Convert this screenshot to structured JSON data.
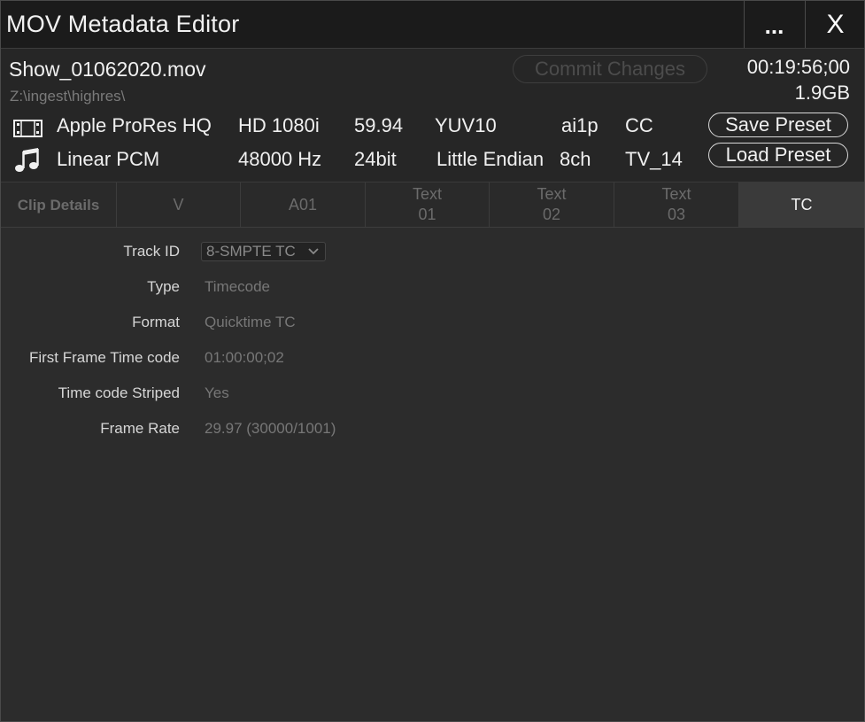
{
  "window": {
    "title": "MOV Metadata Editor",
    "more_label": "...",
    "close_label": "X"
  },
  "file": {
    "name": "Show_01062020.mov",
    "path": "Z:\\ingest\\highres\\",
    "duration": "00:19:56;00",
    "size": "1.9GB",
    "commit_label": "Commit Changes"
  },
  "video": {
    "icon": "film-icon",
    "codec": "Apple ProRes HQ",
    "resolution": "HD 1080i",
    "frame_rate": "59.94",
    "color": "YUV10",
    "fourcc": "ai1p",
    "captions": "CC"
  },
  "audio": {
    "icon": "music-note-icon",
    "codec": "Linear PCM",
    "sample_rate": "48000 Hz",
    "bit_depth": "24bit",
    "endian": "Little Endian",
    "channels": "8ch",
    "rating": "TV_14"
  },
  "presets": {
    "save_label": "Save Preset",
    "load_label": "Load Preset"
  },
  "tabs": [
    {
      "line1": "Clip Details",
      "line2": ""
    },
    {
      "line1": "V",
      "line2": ""
    },
    {
      "line1": "A01",
      "line2": ""
    },
    {
      "line1": "Text",
      "line2": "01"
    },
    {
      "line1": "Text",
      "line2": "02"
    },
    {
      "line1": "Text",
      "line2": "03"
    },
    {
      "line1": "TC",
      "line2": ""
    }
  ],
  "active_tab": "TC",
  "details": {
    "track_id": {
      "label": "Track ID",
      "value": "8-SMPTE TC"
    },
    "type": {
      "label": "Type",
      "value": "Timecode"
    },
    "format": {
      "label": "Format",
      "value": "Quicktime TC"
    },
    "first_frame": {
      "label": "First Frame Time code",
      "value": "01:00:00;02"
    },
    "striped": {
      "label": "Time code Striped",
      "value": "Yes"
    },
    "frame_rate": {
      "label": "Frame Rate",
      "value": "29.97 (30000/1001)"
    }
  },
  "colors": {
    "background": "#2c2c2c",
    "titlebar": "#1b1b1b",
    "active_tab": "#3a3a3a",
    "muted_text": "#777777"
  }
}
